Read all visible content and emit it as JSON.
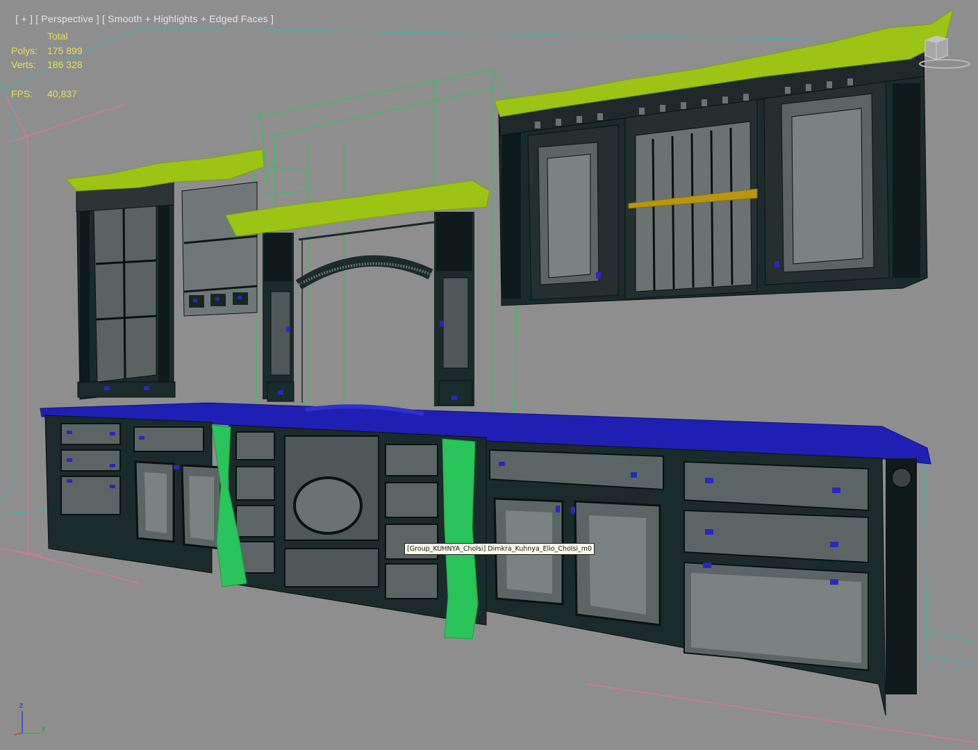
{
  "viewport": {
    "label_plus": "[ + ]",
    "label_view": "[ Perspective ]",
    "label_shading": "[ Smooth + Highlights + Edged Faces ]"
  },
  "stats": {
    "header": "Total",
    "polys_label": "Polys:",
    "polys_value": "175 899",
    "verts_label": "Verts:",
    "verts_value": "186 328",
    "fps_label": "FPS:",
    "fps_value": "40,837"
  },
  "tooltip": {
    "text": "[Group_KUHNYA_Cholsi] Dimkra_Kuhnya_Elio_Cholsi_m0"
  },
  "axis": {
    "z": "z",
    "y": "y"
  },
  "colors": {
    "background": "#8e8e8e",
    "stats_text": "#e5e05a",
    "cornice": "#9cc414",
    "countertop": "#1f1fb4",
    "legs": "#29c45a",
    "cabinet_fill": "#1b2a2a",
    "bbox_green": "#2ec45a",
    "bbox_pink": "#e870a0",
    "bbox_teal": "#3fb3a0"
  },
  "icons": [
    "viewcube-icon",
    "axis-tripod-icon"
  ]
}
